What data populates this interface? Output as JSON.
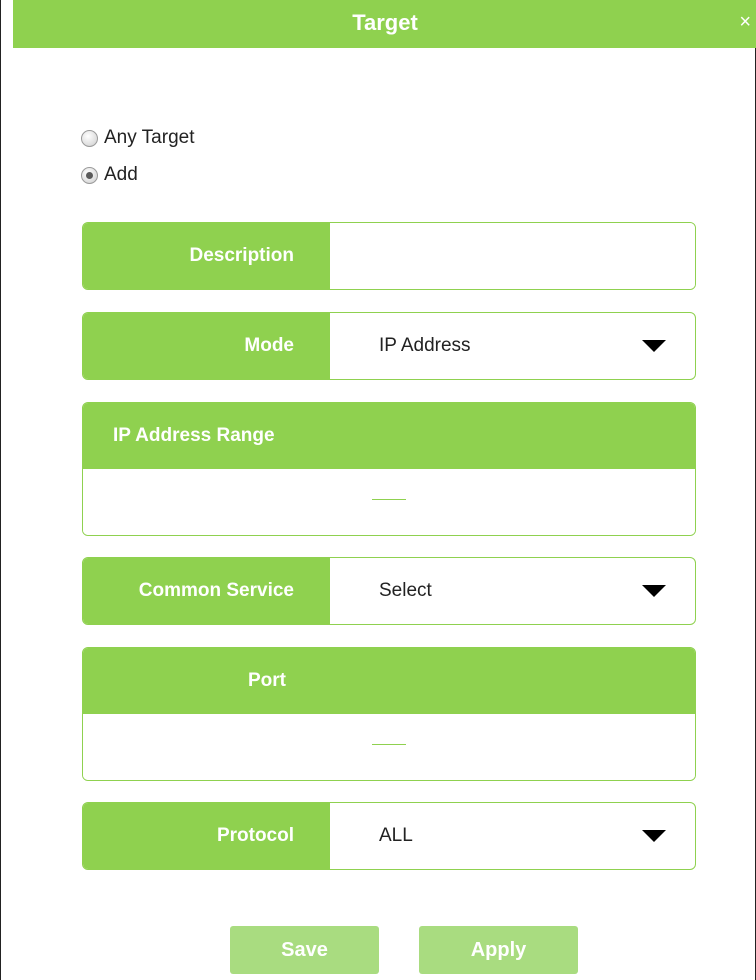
{
  "dialog": {
    "title": "Target",
    "close_glyph": "×"
  },
  "target_mode": {
    "options": [
      {
        "label": "Any Target",
        "checked": false
      },
      {
        "label": "Add",
        "checked": true
      }
    ]
  },
  "form": {
    "description": {
      "label": "Description",
      "value": ""
    },
    "mode": {
      "label": "Mode",
      "selected": "IP Address"
    },
    "ip_range": {
      "label": "IP Address Range",
      "separator": "—"
    },
    "common_service": {
      "label": "Common Service",
      "selected": "Select"
    },
    "port": {
      "label": "Port",
      "separator": "—"
    },
    "protocol": {
      "label": "Protocol",
      "selected": "ALL"
    }
  },
  "actions": {
    "save_label": "Save",
    "apply_label": "Apply"
  },
  "colors": {
    "accent": "#8fd14f",
    "button": "#a9dc80"
  }
}
